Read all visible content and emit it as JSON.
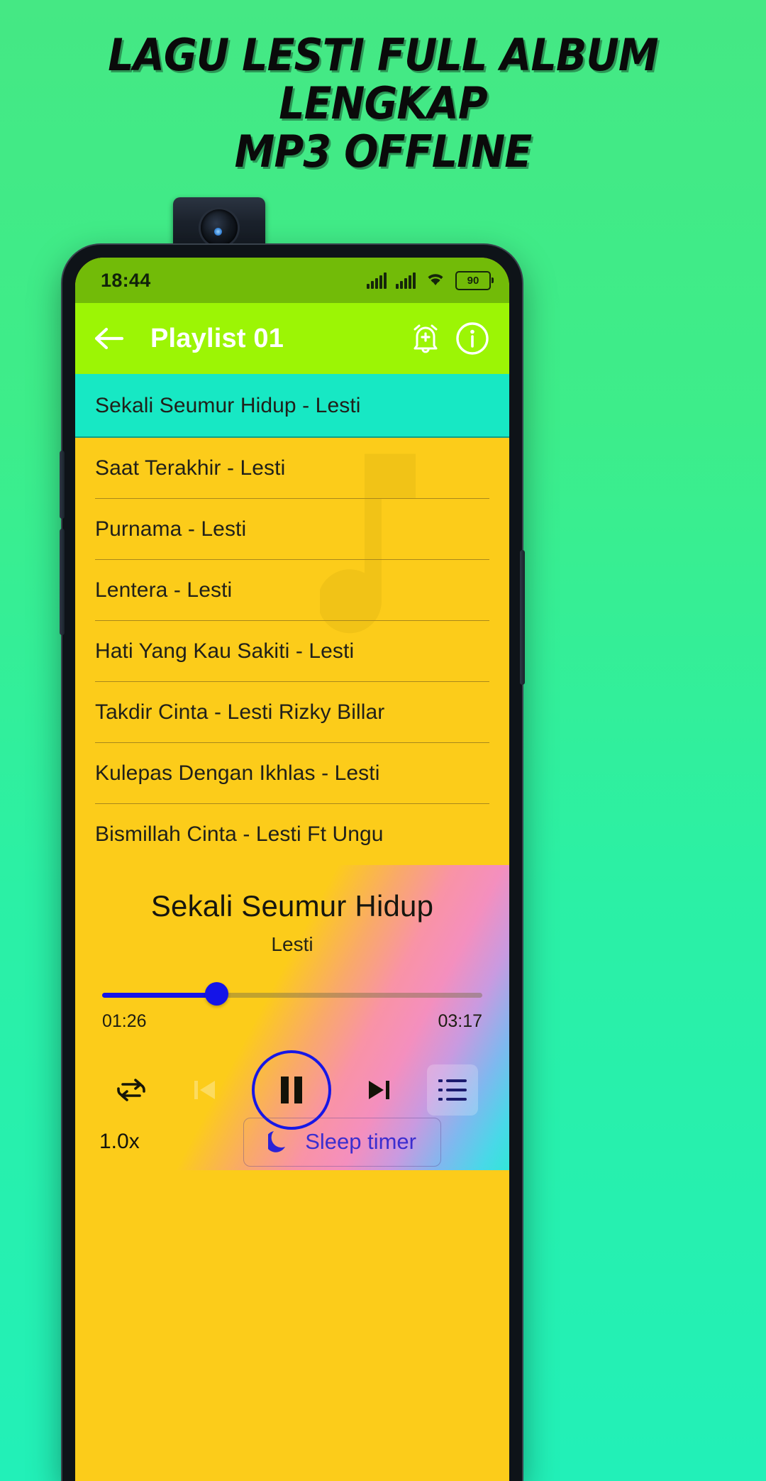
{
  "promo": {
    "line1": "LAGU LESTI FULL ALBUM LENGKAP",
    "line2": "MP3 OFFLINE"
  },
  "device": {
    "camera_icon": "popup-camera-icon",
    "background_color": "#3ded8a"
  },
  "statusbar": {
    "time": "18:44",
    "battery_level": "90",
    "signal_icon": "cellular-signal-icon",
    "wifi_icon": "wifi-icon",
    "battery_icon": "battery-icon",
    "background_color": "#72bb08"
  },
  "appbar": {
    "title": "Playlist 01",
    "back_icon": "back-arrow-icon",
    "alarm_icon": "alarm-add-icon",
    "info_icon": "info-icon",
    "background_color": "#9cf505"
  },
  "playlist": {
    "active_index": 0,
    "active_color": "#17e8c4",
    "row_color": "#FCCC1A",
    "items": [
      {
        "title": "Sekali Seumur Hidup - Lesti"
      },
      {
        "title": "Saat Terakhir - Lesti"
      },
      {
        "title": "Purnama - Lesti"
      },
      {
        "title": "Lentera - Lesti"
      },
      {
        "title": "Hati Yang Kau Sakiti - Lesti"
      },
      {
        "title": "Takdir Cinta - Lesti  Rizky Billar"
      },
      {
        "title": "Kulepas Dengan Ikhlas - Lesti"
      },
      {
        "title": "Bismillah Cinta - Lesti Ft Ungu"
      }
    ]
  },
  "player": {
    "now_playing_title": "Sekali Seumur Hidup",
    "now_playing_artist": "Lesti",
    "elapsed": "01:26",
    "duration": "03:17",
    "progress_percent": 30,
    "accent_color": "#1414e8",
    "repeat_icon": "repeat-icon",
    "previous_icon": "previous-track-icon",
    "play_pause_icon": "pause-icon",
    "next_icon": "next-track-icon",
    "queue_icon": "queue-list-icon",
    "speed": "1.0x",
    "sleep_timer_label": "Sleep timer",
    "sleep_timer_icon": "moon-icon"
  }
}
